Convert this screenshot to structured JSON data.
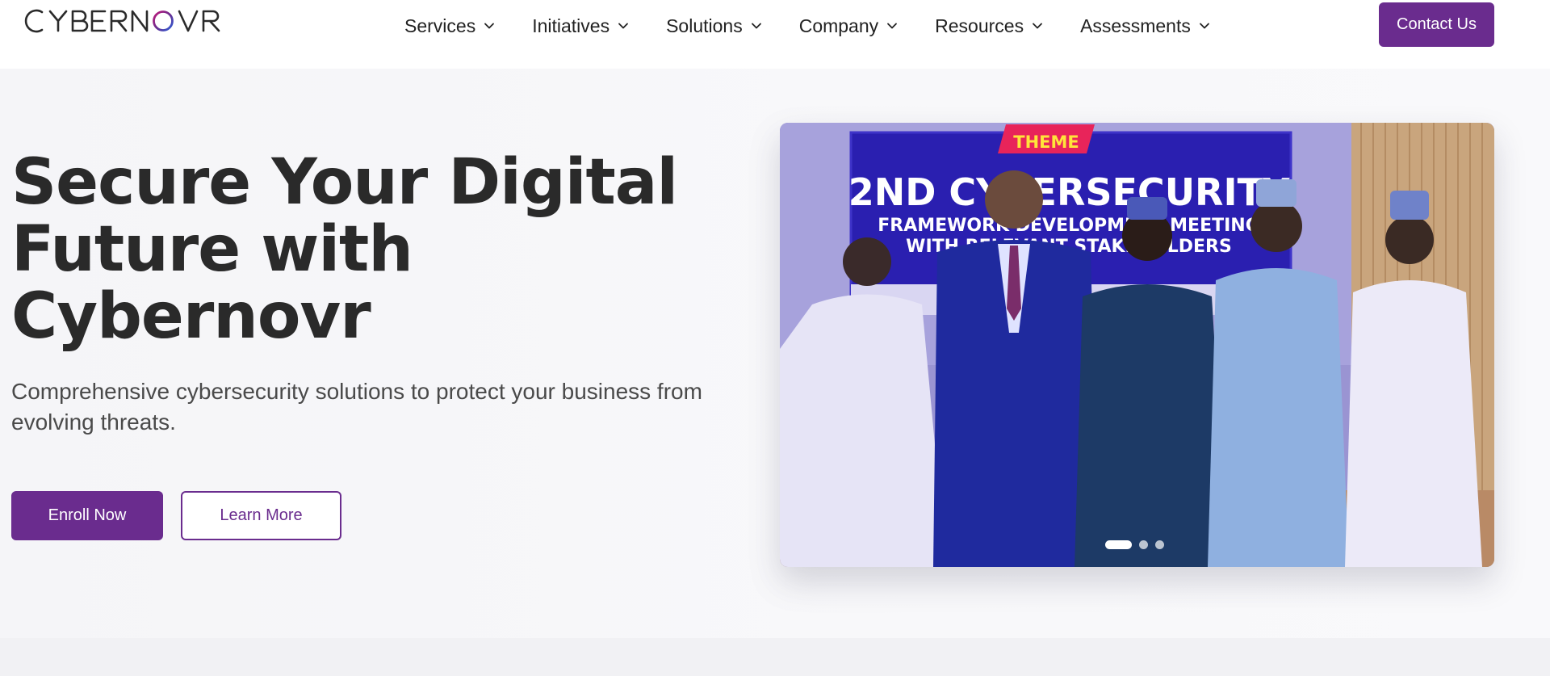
{
  "header": {
    "logo_text": "CYBERNOVR",
    "nav": [
      {
        "label": "Services",
        "icon": "chevron-down-icon"
      },
      {
        "label": "Initiatives",
        "icon": "chevron-down-icon"
      },
      {
        "label": "Solutions",
        "icon": "chevron-down-icon"
      },
      {
        "label": "Company",
        "icon": "chevron-down-icon"
      },
      {
        "label": "Resources",
        "icon": "chevron-down-icon"
      },
      {
        "label": "Assessments",
        "icon": "chevron-down-icon"
      }
    ],
    "contact_label": "Contact Us"
  },
  "hero": {
    "title": "Secure Your Digital Future with Cybernovr",
    "subtitle": "Comprehensive cybersecurity solutions to protect your business from evolving threats.",
    "primary_cta": "Enroll Now",
    "secondary_cta": "Learn More"
  },
  "carousel": {
    "banner_theme": "THEME",
    "banner_line1": "2ND CYBERSECURITY",
    "banner_line2": "FRAMEWORK DEVELOPMENT MEETING",
    "banner_line3": "WITH RELEVANT STAKEHOLDERS",
    "slide_count": 3,
    "active_slide": 1
  },
  "colors": {
    "brand": "#6a2c8e",
    "logo_accent": "#c2187a",
    "text_dark": "#2a2a2a",
    "banner_blue": "#2a1fb0",
    "banner_tag": "#e8245a"
  }
}
